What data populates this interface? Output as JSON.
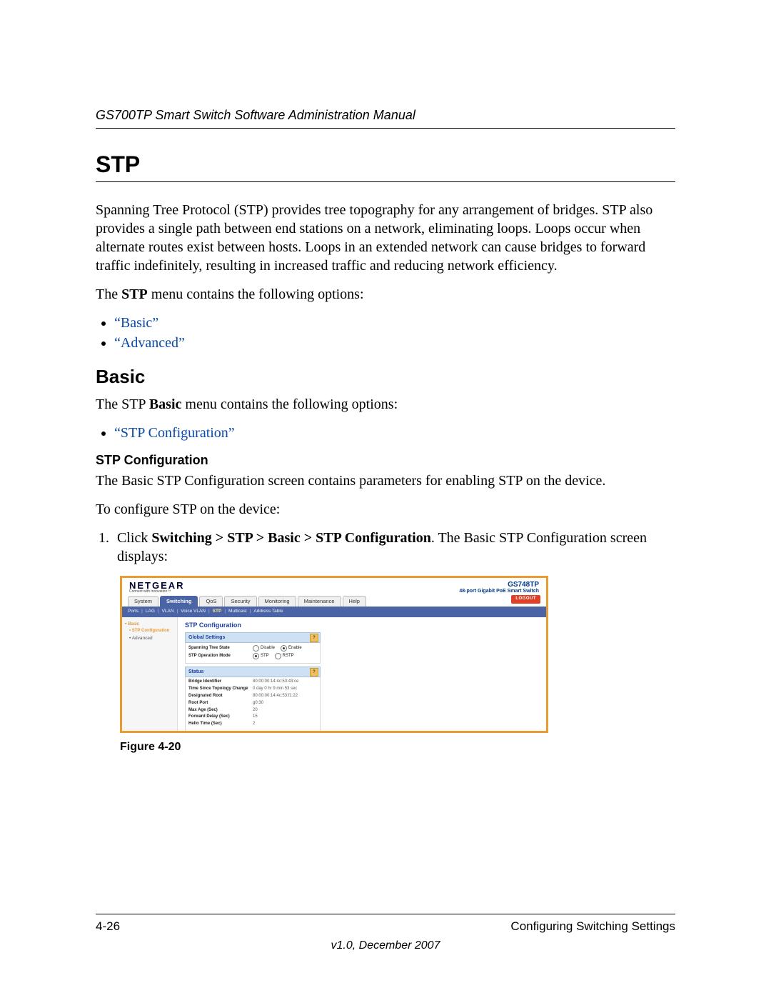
{
  "header": {
    "running": "GS700TP Smart Switch Software Administration Manual"
  },
  "section": {
    "title": "STP",
    "intro": "Spanning Tree Protocol (STP) provides tree topography for any arrangement of bridges. STP also provides a single path between end stations on a network, eliminating loops. Loops occur when alternate routes exist between hosts. Loops in an extended network can cause bridges to forward traffic indefinitely, resulting in increased traffic and reducing network efficiency.",
    "menu_sentence_pre": "The ",
    "menu_sentence_bold": "STP",
    "menu_sentence_post": " menu contains the following options:",
    "options": [
      "“Basic”",
      "“Advanced”"
    ]
  },
  "basic": {
    "title": "Basic",
    "menu_sentence_pre": "The STP ",
    "menu_sentence_bold": "Basic",
    "menu_sentence_post": " menu contains the following options:",
    "options": [
      "“STP Configuration”"
    ]
  },
  "stpconfig": {
    "title": "STP Configuration",
    "desc": "The Basic STP Configuration screen contains parameters for enabling STP on the device.",
    "lead": "To configure STP on the device:",
    "step_pre": "Click ",
    "step_bold": "Switching > STP > Basic > STP Configuration",
    "step_post": ". The Basic STP Configuration screen displays:"
  },
  "figure": {
    "caption": "Figure 4-20"
  },
  "shot": {
    "brand": "NETGEAR",
    "brand_tag": "Connect with Innovation™",
    "product_model": "GS748TP",
    "product_desc": "48-port Gigabit PoE Smart Switch",
    "logout": "LOGOUT",
    "tabs": [
      "System",
      "Switching",
      "QoS",
      "Security",
      "Monitoring",
      "Maintenance",
      "Help"
    ],
    "active_tab": "Switching",
    "subnav": [
      "Ports",
      "LAG",
      "VLAN",
      "Voice VLAN",
      "STP",
      "Multicast",
      "Address Table"
    ],
    "subnav_selected": "STP",
    "sidebar": {
      "group": "• Basic",
      "selected": "• STP Configuration",
      "other": "• Advanced"
    },
    "main_title": "STP Configuration",
    "global": {
      "head": "Global Settings",
      "rows": {
        "state_label": "Spanning Tree State",
        "state_opt1": "Disable",
        "state_opt2": "Enable",
        "mode_label": "STP Operation Mode",
        "mode_opt1": "STP",
        "mode_opt2": "RSTP"
      }
    },
    "status": {
      "head": "Status",
      "rows": [
        {
          "label": "Bridge Identifier",
          "value": "80:00:00:14:4c:53:43:ce"
        },
        {
          "label": "Time Since Topology Change",
          "value": "0 day 0 hr 9 min 53 sec"
        },
        {
          "label": "Designated Root",
          "value": "80:00:00:14:4c:53:f1:22"
        },
        {
          "label": "Root Port",
          "value": "g0:30"
        },
        {
          "label": "Max Age (Sec)",
          "value": "20"
        },
        {
          "label": "Forward Delay (Sec)",
          "value": "15"
        },
        {
          "label": "Hello Time (Sec)",
          "value": "2"
        }
      ]
    }
  },
  "footer": {
    "page": "4-26",
    "chapter": "Configuring Switching Settings",
    "version": "v1.0, December 2007"
  }
}
